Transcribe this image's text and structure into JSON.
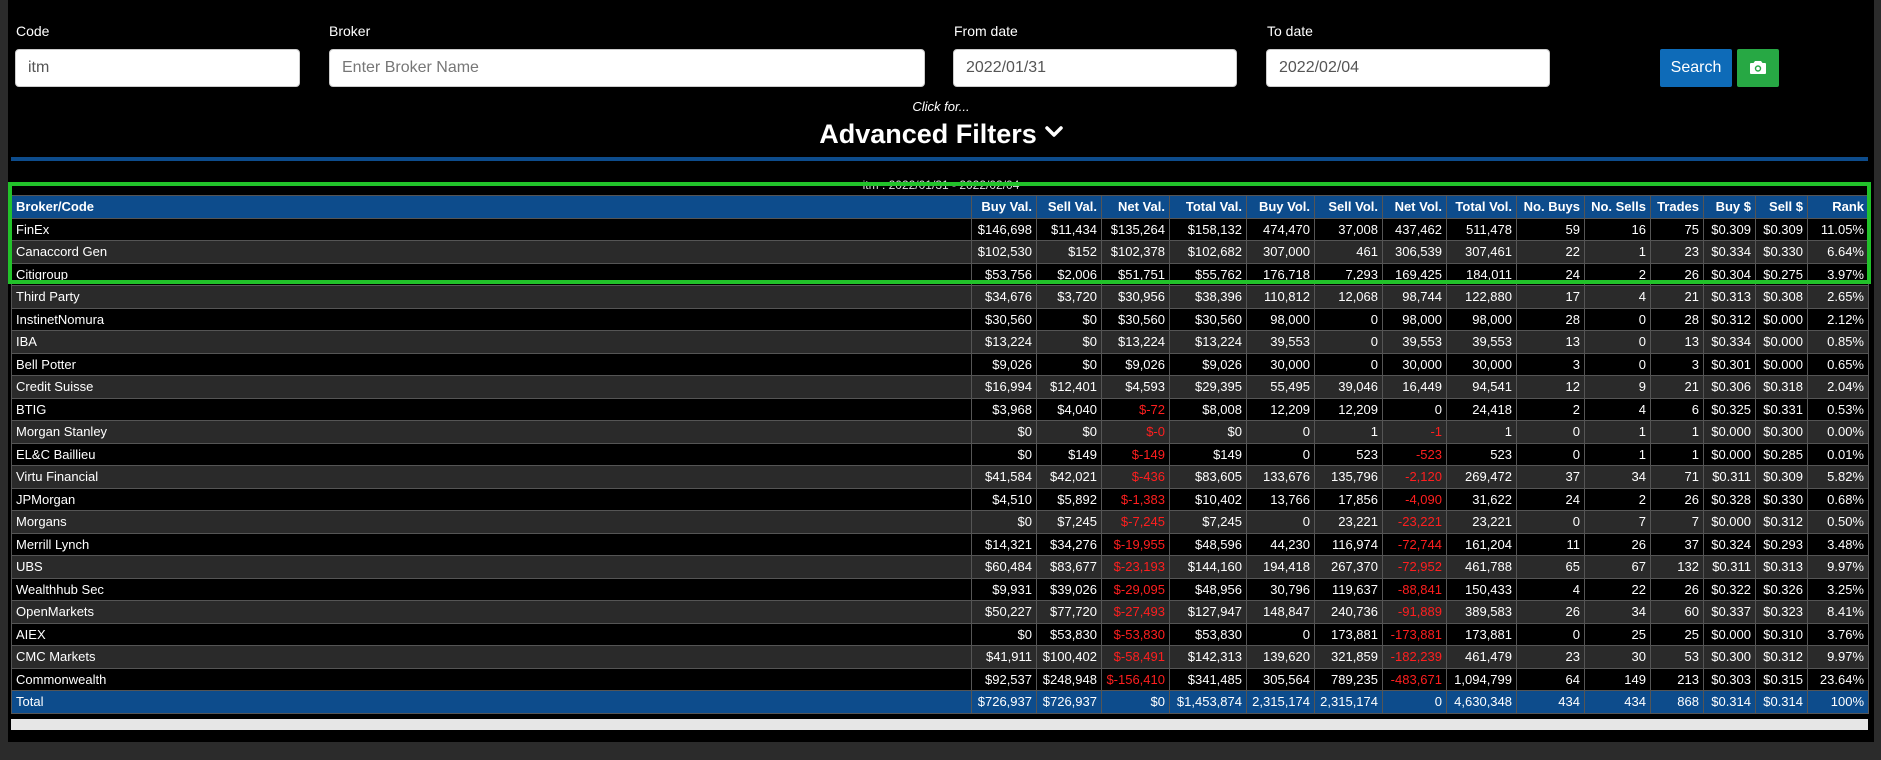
{
  "filters": {
    "code_label": "Code",
    "code_value": "itm",
    "broker_label": "Broker",
    "broker_placeholder": "Enter Broker Name",
    "from_label": "From date",
    "from_value": "2022/01/31",
    "to_label": "To date",
    "to_value": "2022/02/04",
    "search_label": "Search",
    "camera_icon": "camera-icon"
  },
  "advanced": {
    "click_for": "Click for...",
    "title": "Advanced Filters",
    "chevron_icon": "chevron-down-icon"
  },
  "caption": "itm : 2022/01/31 - 2022/02/04",
  "colors": {
    "header_blue": "#0d4c8c",
    "search_blue": "#0e6bb8",
    "camera_green": "#27a844",
    "negative_red": "#ff1f1f",
    "highlight_green": "#22c22a"
  },
  "table": {
    "headers": [
      "Broker/Code",
      "Buy Val.",
      "Sell Val.",
      "Net Val.",
      "Total Val.",
      "Buy Vol.",
      "Sell Vol.",
      "Net Vol.",
      "Total Vol.",
      "No. Buys",
      "No. Sells",
      "Trades",
      "Buy $",
      "Sell $",
      "Rank"
    ],
    "rows": [
      [
        "FinEx",
        "$146,698",
        "$11,434",
        "$135,264",
        "$158,132",
        "474,470",
        "37,008",
        "437,462",
        "511,478",
        "59",
        "16",
        "75",
        "$0.309",
        "$0.309",
        "11.05%"
      ],
      [
        "Canaccord Gen",
        "$102,530",
        "$152",
        "$102,378",
        "$102,682",
        "307,000",
        "461",
        "306,539",
        "307,461",
        "22",
        "1",
        "23",
        "$0.334",
        "$0.330",
        "6.64%"
      ],
      [
        "Citigroup",
        "$53,756",
        "$2,006",
        "$51,751",
        "$55,762",
        "176,718",
        "7,293",
        "169,425",
        "184,011",
        "24",
        "2",
        "26",
        "$0.304",
        "$0.275",
        "3.97%"
      ],
      [
        "Third Party",
        "$34,676",
        "$3,720",
        "$30,956",
        "$38,396",
        "110,812",
        "12,068",
        "98,744",
        "122,880",
        "17",
        "4",
        "21",
        "$0.313",
        "$0.308",
        "2.65%"
      ],
      [
        "InstinetNomura",
        "$30,560",
        "$0",
        "$30,560",
        "$30,560",
        "98,000",
        "0",
        "98,000",
        "98,000",
        "28",
        "0",
        "28",
        "$0.312",
        "$0.000",
        "2.12%"
      ],
      [
        "IBA",
        "$13,224",
        "$0",
        "$13,224",
        "$13,224",
        "39,553",
        "0",
        "39,553",
        "39,553",
        "13",
        "0",
        "13",
        "$0.334",
        "$0.000",
        "0.85%"
      ],
      [
        "Bell Potter",
        "$9,026",
        "$0",
        "$9,026",
        "$9,026",
        "30,000",
        "0",
        "30,000",
        "30,000",
        "3",
        "0",
        "3",
        "$0.301",
        "$0.000",
        "0.65%"
      ],
      [
        "Credit Suisse",
        "$16,994",
        "$12,401",
        "$4,593",
        "$29,395",
        "55,495",
        "39,046",
        "16,449",
        "94,541",
        "12",
        "9",
        "21",
        "$0.306",
        "$0.318",
        "2.04%"
      ],
      [
        "BTIG",
        "$3,968",
        "$4,040",
        "$-72",
        "$8,008",
        "12,209",
        "12,209",
        "0",
        "24,418",
        "2",
        "4",
        "6",
        "$0.325",
        "$0.331",
        "0.53%"
      ],
      [
        "Morgan Stanley",
        "$0",
        "$0",
        "$-0",
        "$0",
        "0",
        "1",
        "-1",
        "1",
        "0",
        "1",
        "1",
        "$0.000",
        "$0.300",
        "0.00%"
      ],
      [
        "EL&C Baillieu",
        "$0",
        "$149",
        "$-149",
        "$149",
        "0",
        "523",
        "-523",
        "523",
        "0",
        "1",
        "1",
        "$0.000",
        "$0.285",
        "0.01%"
      ],
      [
        "Virtu Financial",
        "$41,584",
        "$42,021",
        "$-436",
        "$83,605",
        "133,676",
        "135,796",
        "-2,120",
        "269,472",
        "37",
        "34",
        "71",
        "$0.311",
        "$0.309",
        "5.82%"
      ],
      [
        "JPMorgan",
        "$4,510",
        "$5,892",
        "$-1,383",
        "$10,402",
        "13,766",
        "17,856",
        "-4,090",
        "31,622",
        "24",
        "2",
        "26",
        "$0.328",
        "$0.330",
        "0.68%"
      ],
      [
        "Morgans",
        "$0",
        "$7,245",
        "$-7,245",
        "$7,245",
        "0",
        "23,221",
        "-23,221",
        "23,221",
        "0",
        "7",
        "7",
        "$0.000",
        "$0.312",
        "0.50%"
      ],
      [
        "Merrill Lynch",
        "$14,321",
        "$34,276",
        "$-19,955",
        "$48,596",
        "44,230",
        "116,974",
        "-72,744",
        "161,204",
        "11",
        "26",
        "37",
        "$0.324",
        "$0.293",
        "3.48%"
      ],
      [
        "UBS",
        "$60,484",
        "$83,677",
        "$-23,193",
        "$144,160",
        "194,418",
        "267,370",
        "-72,952",
        "461,788",
        "65",
        "67",
        "132",
        "$0.311",
        "$0.313",
        "9.97%"
      ],
      [
        "Wealthhub Sec",
        "$9,931",
        "$39,026",
        "$-29,095",
        "$48,956",
        "30,796",
        "119,637",
        "-88,841",
        "150,433",
        "4",
        "22",
        "26",
        "$0.322",
        "$0.326",
        "3.25%"
      ],
      [
        "OpenMarkets",
        "$50,227",
        "$77,720",
        "$-27,493",
        "$127,947",
        "148,847",
        "240,736",
        "-91,889",
        "389,583",
        "26",
        "34",
        "60",
        "$0.337",
        "$0.323",
        "8.41%"
      ],
      [
        "AIEX",
        "$0",
        "$53,830",
        "$-53,830",
        "$53,830",
        "0",
        "173,881",
        "-173,881",
        "173,881",
        "0",
        "25",
        "25",
        "$0.000",
        "$0.310",
        "3.76%"
      ],
      [
        "CMC Markets",
        "$41,911",
        "$100,402",
        "$-58,491",
        "$142,313",
        "139,620",
        "321,859",
        "-182,239",
        "461,479",
        "23",
        "30",
        "53",
        "$0.300",
        "$0.312",
        "9.97%"
      ],
      [
        "Commonwealth",
        "$92,537",
        "$248,948",
        "$-156,410",
        "$341,485",
        "305,564",
        "789,235",
        "-483,671",
        "1,094,799",
        "64",
        "149",
        "213",
        "$0.303",
        "$0.315",
        "23.64%"
      ]
    ],
    "total": [
      "Total",
      "$726,937",
      "$726,937",
      "$0",
      "$1,453,874",
      "2,315,174",
      "2,315,174",
      "0",
      "4,630,348",
      "434",
      "434",
      "868",
      "$0.314",
      "$0.314",
      "100%"
    ]
  }
}
